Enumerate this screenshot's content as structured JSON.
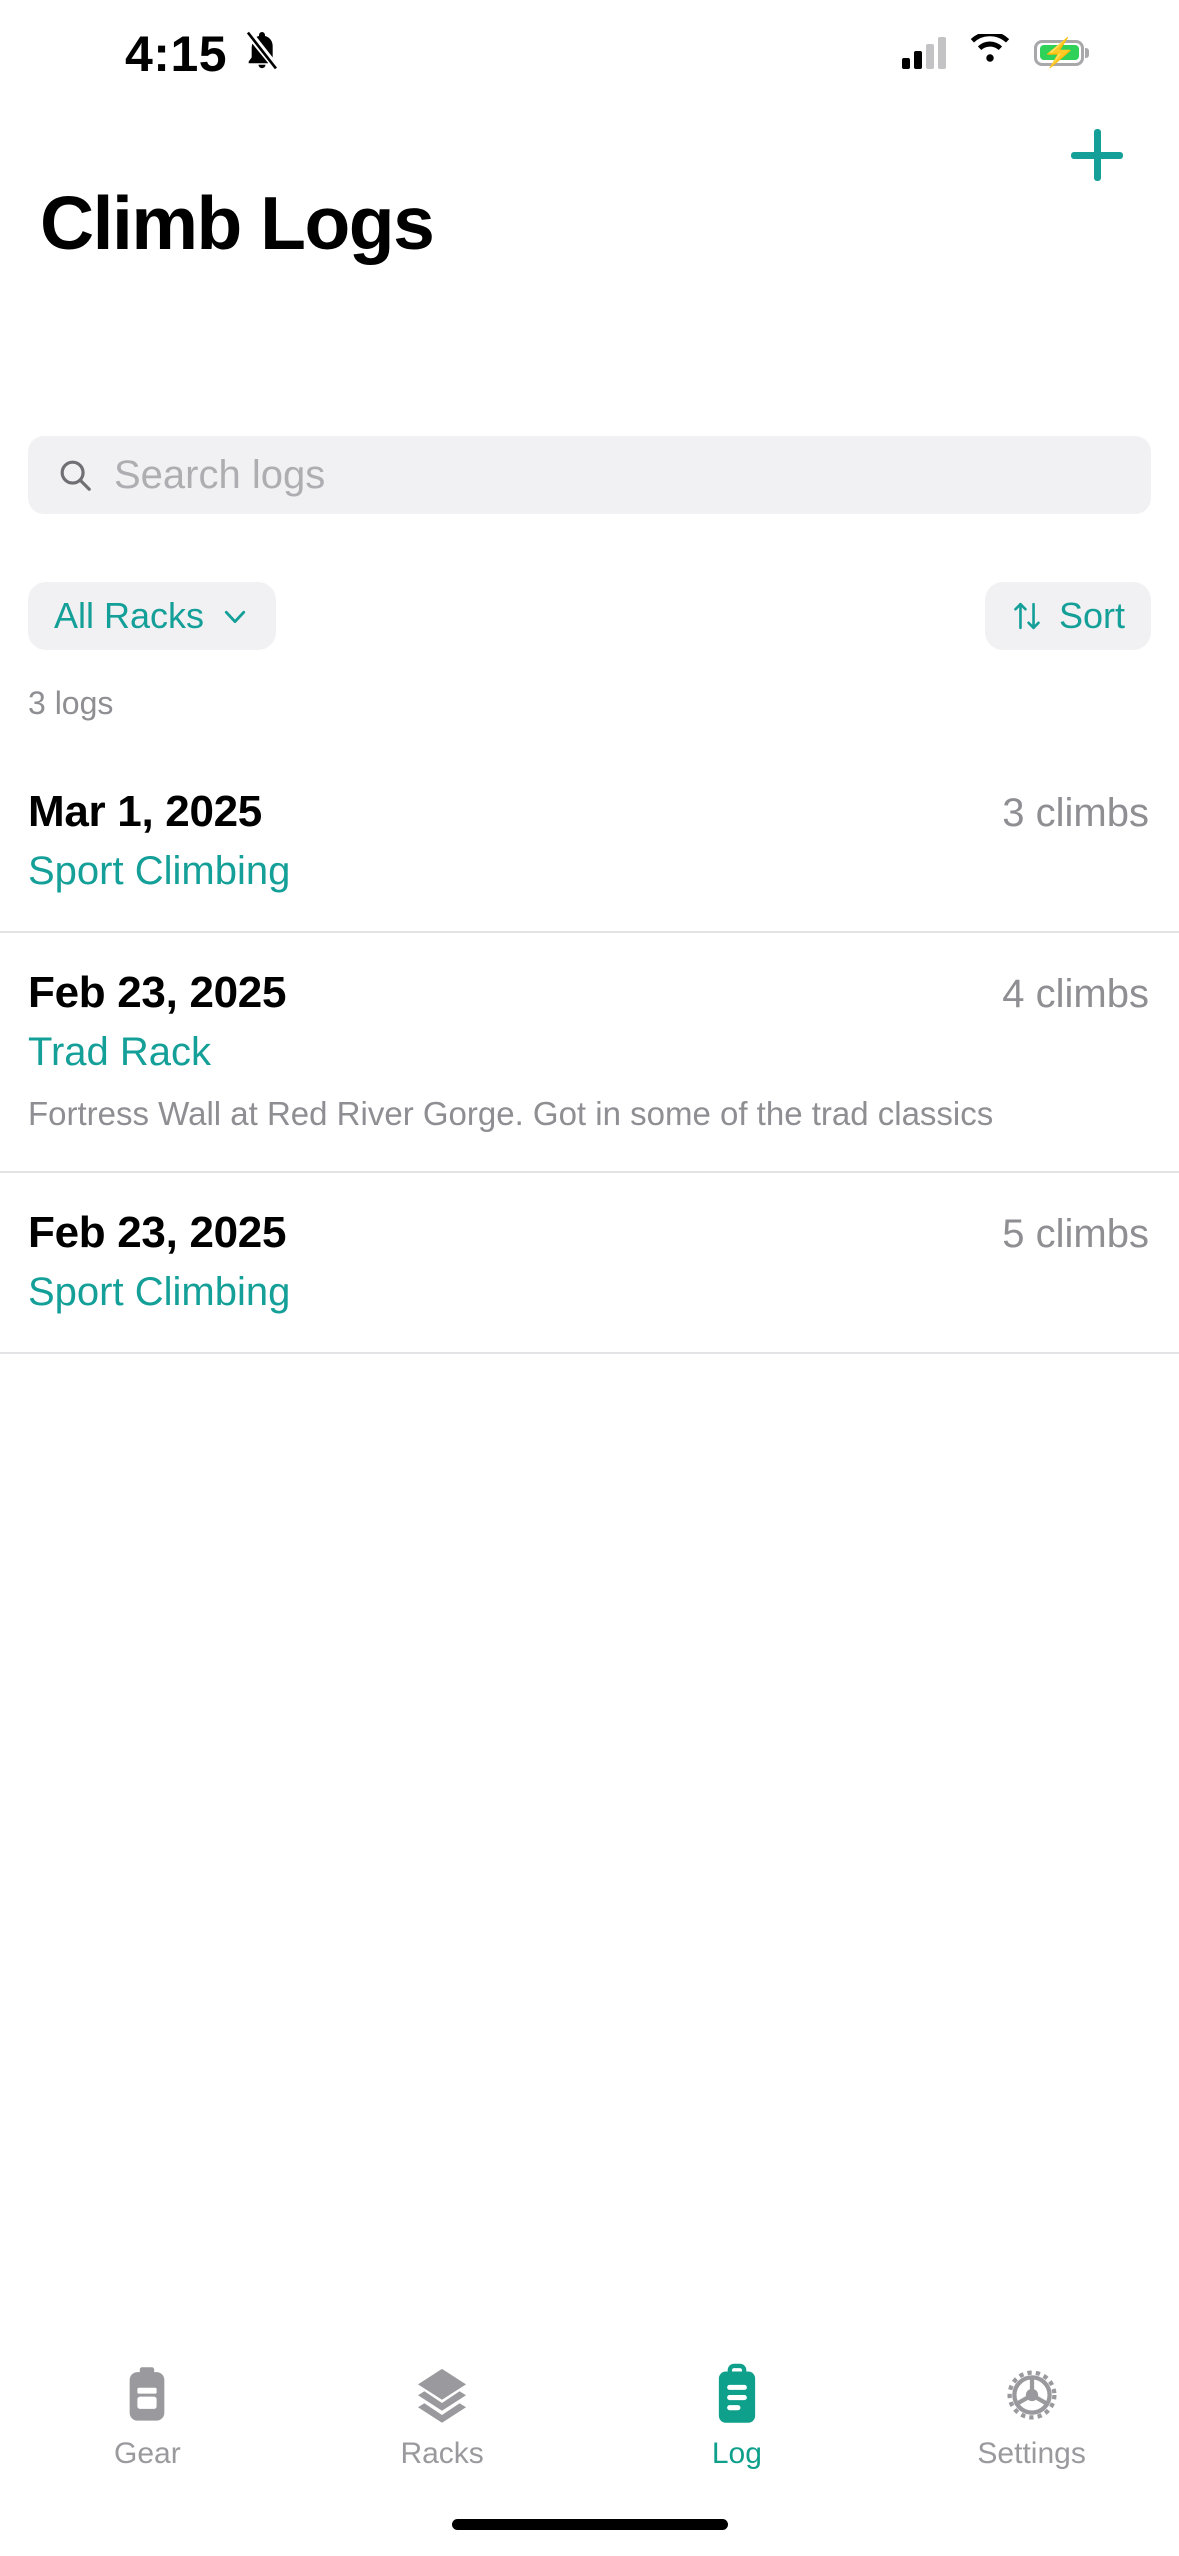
{
  "status_bar": {
    "time": "4:15",
    "silent_icon": "bell-slash-icon",
    "cellular_icon": "cellular-bars-icon",
    "cellular_bars_filled": 2,
    "cellular_bars_total": 4,
    "wifi_icon": "wifi-icon",
    "battery_icon": "battery-charging-icon",
    "battery_color": "#30D158"
  },
  "nav": {
    "add_icon": "plus-icon",
    "add_label": "Add log"
  },
  "header": {
    "title": "Climb Logs"
  },
  "search": {
    "icon": "search-icon",
    "value": "",
    "placeholder": "Search logs"
  },
  "filters": {
    "rack_filter_label": "All Racks",
    "rack_filter_icon": "chevron-down-icon",
    "sort_label": "Sort",
    "sort_icon": "sort-arrows-icon"
  },
  "list": {
    "count_label": "3 logs",
    "rows": [
      {
        "date": "Mar 1, 2025",
        "climbs": "3 climbs",
        "rack": "Sport Climbing",
        "note": ""
      },
      {
        "date": "Feb 23, 2025",
        "climbs": "4 climbs",
        "rack": "Trad Rack",
        "note": "Fortress Wall at Red River Gorge. Got in some of the trad classics"
      },
      {
        "date": "Feb 23, 2025",
        "climbs": "5 climbs",
        "rack": "Sport Climbing",
        "note": ""
      }
    ]
  },
  "tab_bar": {
    "active_index": 2,
    "items": [
      {
        "label": "Gear",
        "icon": "backpack-icon"
      },
      {
        "label": "Racks",
        "icon": "stacked-layers-icon"
      },
      {
        "label": "Log",
        "icon": "clipboard-icon"
      },
      {
        "label": "Settings",
        "icon": "gear-cog-icon"
      }
    ]
  },
  "colors": {
    "accent": "#14A098",
    "accent_active_tab": "#0FA08C",
    "muted_text": "#8E8E93",
    "placeholder": "#AEAEB2",
    "field_bg": "#F1F1F3",
    "divider": "#E3E3E5",
    "battery_green": "#30D158"
  }
}
